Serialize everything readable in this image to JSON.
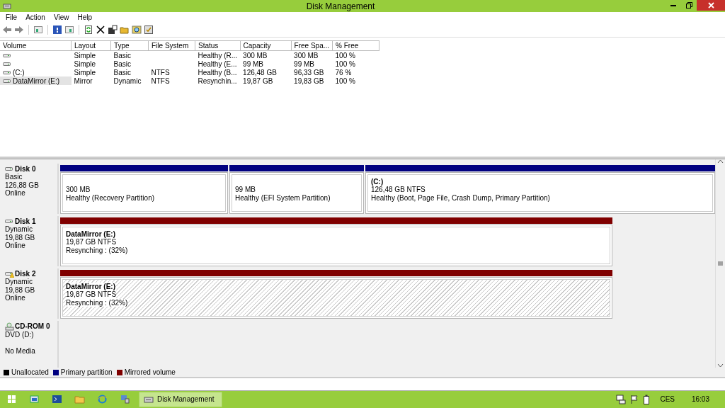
{
  "window": {
    "title": "Disk Management"
  },
  "menu": [
    "File",
    "Action",
    "View",
    "Help"
  ],
  "table": {
    "columns": [
      "Volume",
      "Layout",
      "Type",
      "File System",
      "Status",
      "Capacity",
      "Free Spa...",
      "% Free"
    ],
    "rows": [
      {
        "cells": [
          "",
          "Simple",
          "Basic",
          "",
          "Healthy (R...",
          "300 MB",
          "300 MB",
          "100 %"
        ],
        "selected": false
      },
      {
        "cells": [
          "",
          "Simple",
          "Basic",
          "",
          "Healthy (E...",
          "99 MB",
          "99 MB",
          "100 %"
        ],
        "selected": false
      },
      {
        "cells": [
          "(C:)",
          "Simple",
          "Basic",
          "NTFS",
          "Healthy (B...",
          "126,48 GB",
          "96,33 GB",
          "76 %"
        ],
        "selected": false
      },
      {
        "cells": [
          "DataMirror (E:)",
          "Mirror",
          "Dynamic",
          "NTFS",
          "Resynchin...",
          "19,87 GB",
          "19,83 GB",
          "100 %"
        ],
        "selected": true
      }
    ]
  },
  "disks": [
    {
      "kind": "disk",
      "name": "Disk 0",
      "lines": [
        "Basic",
        "126,88 GB",
        "Online"
      ],
      "warning": false,
      "partitions": [
        {
          "color": "#000080",
          "lines": [
            "300 MB",
            "Healthy (Recovery Partition)"
          ],
          "selected": false
        },
        {
          "color": "#000080",
          "lines": [
            "99 MB",
            "Healthy (EFI System Partition)"
          ],
          "selected": false
        },
        {
          "color": "#000080",
          "name": "(C:)",
          "lines": [
            "126,48 GB NTFS",
            "Healthy (Boot, Page File, Crash Dump, Primary Partition)"
          ],
          "selected": false
        }
      ]
    },
    {
      "kind": "disk",
      "name": "Disk 1",
      "lines": [
        "Dynamic",
        "19,88 GB",
        "Online"
      ],
      "warning": false,
      "partitions": [
        {
          "color": "#800000",
          "name": "DataMirror  (E:)",
          "lines": [
            "19,87 GB NTFS",
            "Resynching : (32%)"
          ],
          "selected": false
        }
      ]
    },
    {
      "kind": "disk",
      "name": "Disk 2",
      "lines": [
        "Dynamic",
        "19,88 GB",
        "Online"
      ],
      "warning": true,
      "partitions": [
        {
          "color": "#800000",
          "name": "DataMirror  (E:)",
          "lines": [
            "19,87 GB NTFS",
            "Resynching : (32%)"
          ],
          "selected": true
        }
      ]
    },
    {
      "kind": "cdrom",
      "name": "CD-ROM 0",
      "lines": [
        "DVD (D:)"
      ],
      "media": "No Media"
    }
  ],
  "legend": [
    {
      "label": "Unallocated",
      "color": "#000000"
    },
    {
      "label": "Primary partition",
      "color": "#000080"
    },
    {
      "label": "Mirrored volume",
      "color": "#800000"
    }
  ],
  "taskbar": {
    "active_app": "Disk Management",
    "language": "CES",
    "time": "16:03"
  }
}
